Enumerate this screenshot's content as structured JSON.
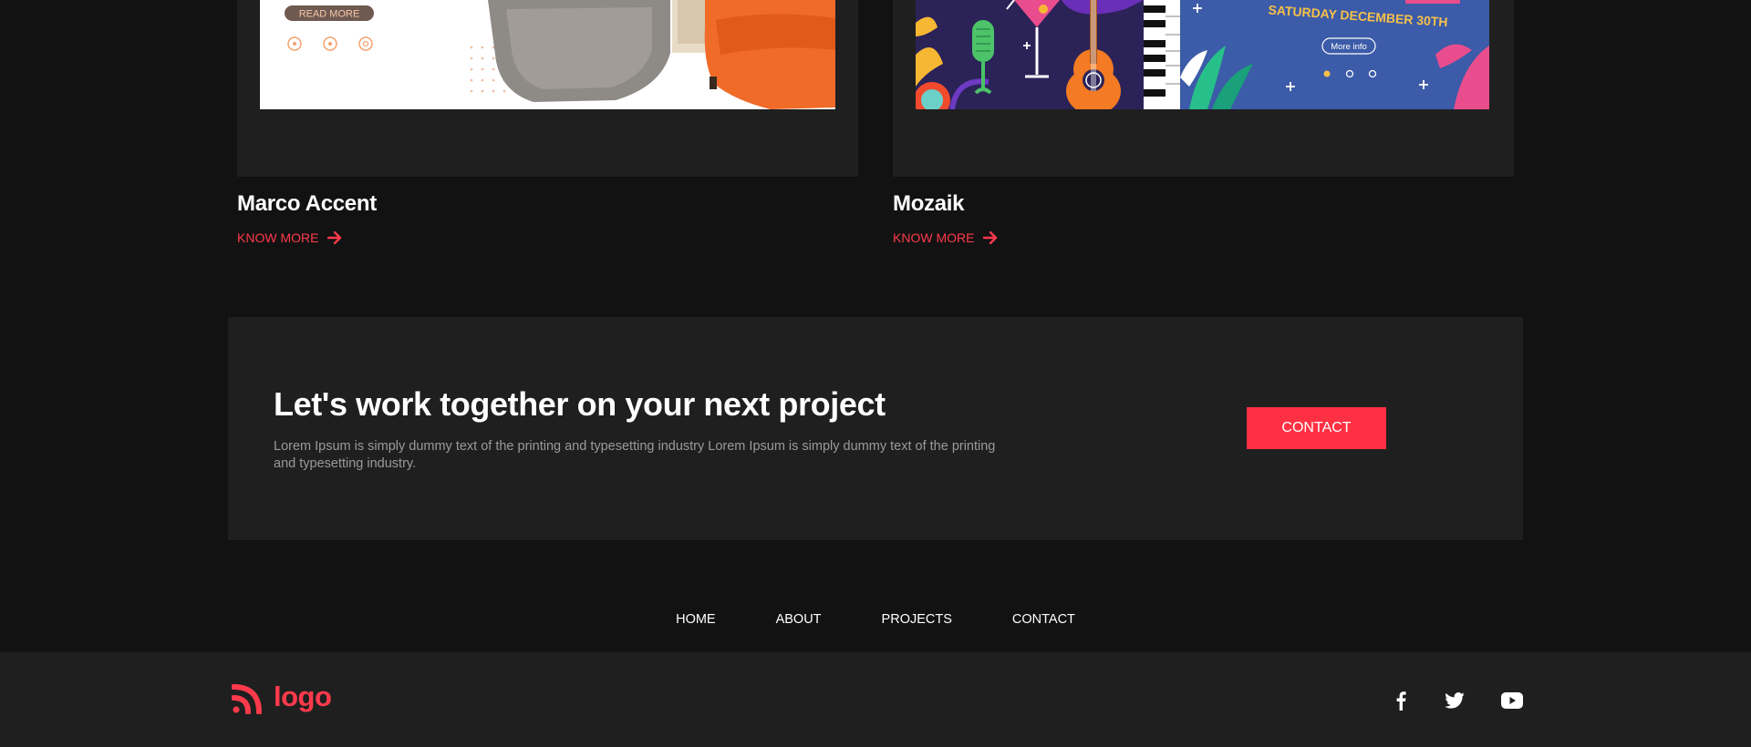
{
  "projects": [
    {
      "title": "Marco Accent",
      "link_label": "KNOW MORE",
      "image": {
        "button": "READ MORE"
      }
    },
    {
      "title": "Mozaik",
      "link_label": "KNOW MORE",
      "image": {
        "headline": "SATURDAY DECEMBER 30TH",
        "button": "More info"
      }
    }
  ],
  "cta": {
    "title": "Let's work together on your next project",
    "text": "Lorem Ipsum is simply dummy text of the printing and typesetting industry Lorem Ipsum is simply dummy text of the printing and typesetting industry.",
    "button_label": "CONTACT"
  },
  "nav": {
    "items": [
      "HOME",
      "ABOUT",
      "PROJECTS",
      "CONTACT"
    ]
  },
  "footer": {
    "logo_text": "logo",
    "social": [
      "facebook-icon",
      "twitter-icon",
      "youtube-icon"
    ]
  },
  "colors": {
    "accent": "#ff3043",
    "background": "#121212",
    "panel": "#1f1f1f"
  }
}
